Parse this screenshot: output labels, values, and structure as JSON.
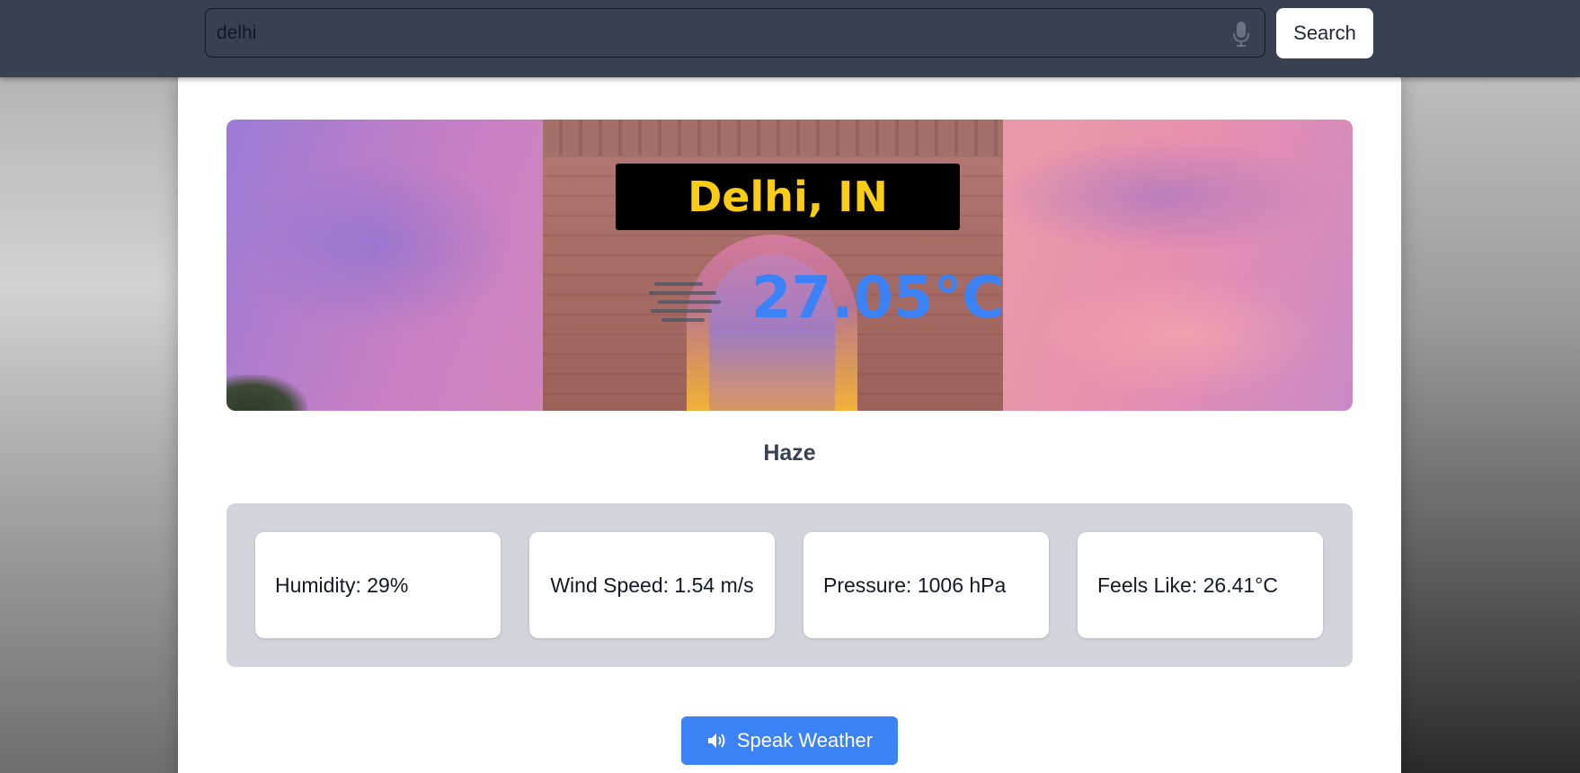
{
  "search": {
    "value": "delhi",
    "button_label": "Search",
    "mic_icon": "microphone-icon"
  },
  "weather": {
    "city": "Delhi, IN",
    "temperature": "27.05°C",
    "condition": "Haze",
    "condition_icon": "haze-icon",
    "stats": {
      "humidity": "Humidity: 29%",
      "wind_speed": "Wind Speed: 1.54 m/s",
      "pressure": "Pressure: 1006 hPa",
      "feels_like": "Feels Like: 26.41°C"
    }
  },
  "actions": {
    "speak_label": "Speak Weather",
    "speak_icon": "speaker-icon"
  },
  "colors": {
    "topbar": "#374151",
    "city_text": "#facc15",
    "temperature": "#3b82f6",
    "button_primary": "#3b82f6",
    "stats_panel": "#d1d5db"
  }
}
